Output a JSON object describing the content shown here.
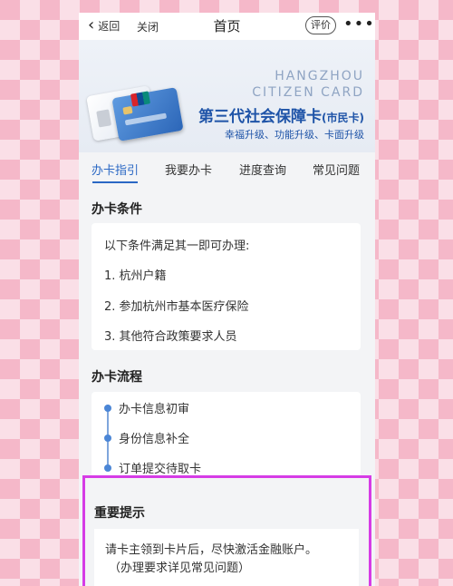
{
  "navbar": {
    "back_label": "返回",
    "close_label": "关闭",
    "title": "首页",
    "rate_label": "评价",
    "more_label": "•••"
  },
  "banner": {
    "en_line1": "HANGZHOU",
    "en_line2": "CITIZEN CARD",
    "title_main": "第三代社会保障卡",
    "title_suffix": "(市民卡)",
    "subtitle": "幸福升级、功能升级、卡面升级"
  },
  "tabs": [
    {
      "label": "办卡指引",
      "active": true
    },
    {
      "label": "我要办卡",
      "active": false
    },
    {
      "label": "进度查询",
      "active": false
    },
    {
      "label": "常见问题",
      "active": false
    }
  ],
  "conditions": {
    "title": "办卡条件",
    "intro": "以下条件满足其一即可办理:",
    "items": [
      "1. 杭州户籍",
      "2. 参加杭州市基本医疗保险",
      "3. 其他符合政策要求人员"
    ]
  },
  "process": {
    "title": "办卡流程",
    "steps": [
      "办卡信息初审",
      "身份信息补全",
      "订单提交待取卡"
    ]
  },
  "notice": {
    "title": "重要提示",
    "line1": "请卡主领到卡片后，尽快激活金融账户。",
    "line2": "（办理要求详见常见问题）"
  },
  "colors": {
    "accent": "#2a67c4",
    "highlight_border": "#d63ce6"
  }
}
